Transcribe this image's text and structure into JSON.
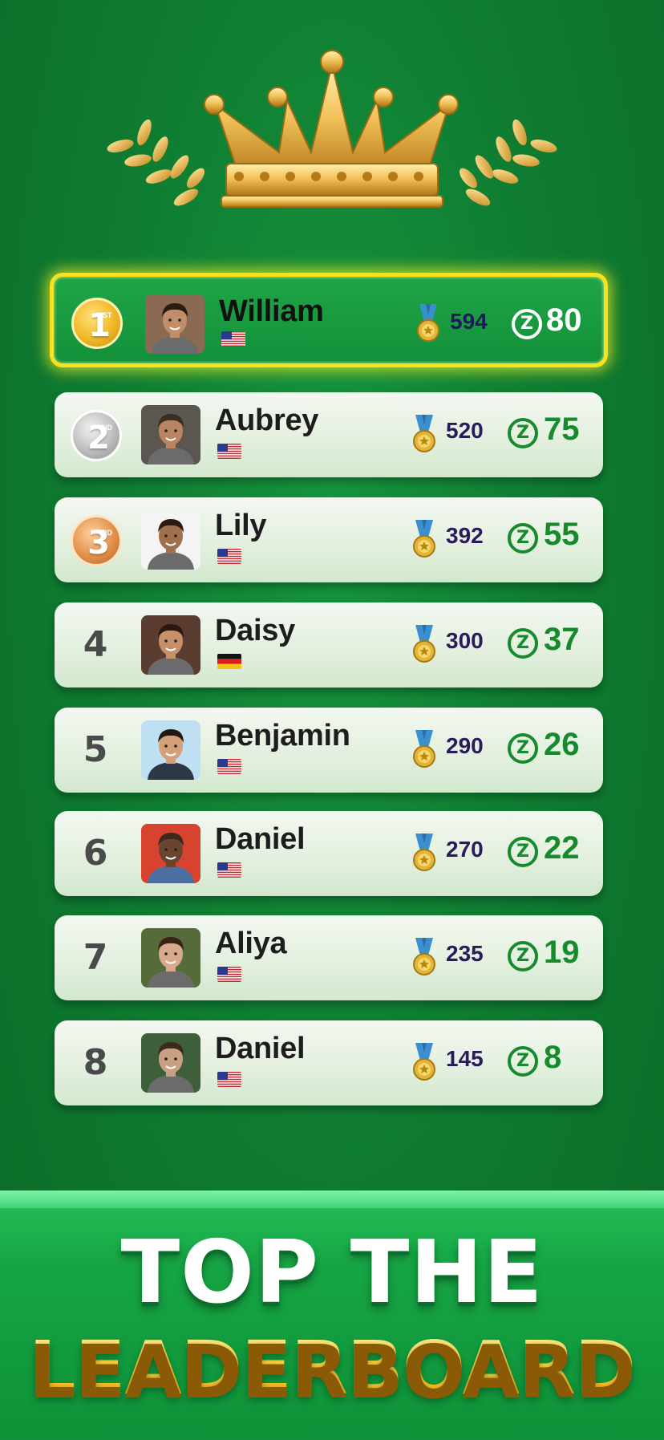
{
  "leaderboard": [
    {
      "rank": "1",
      "rank_suffix": "ST",
      "name": "William",
      "flag": "us-flag",
      "score": "594",
      "points": "80",
      "avatar_bg": "#8a6a52",
      "skin": "#c18d6a",
      "hair": "#2a1b12"
    },
    {
      "rank": "2",
      "rank_suffix": "ND",
      "name": "Aubrey",
      "flag": "us-flag",
      "score": "520",
      "points": "75",
      "avatar_bg": "#5b5650",
      "skin": "#b98562",
      "hair": "#3a2d22"
    },
    {
      "rank": "3",
      "rank_suffix": "RD",
      "name": "Lily",
      "flag": "us-flag",
      "score": "392",
      "points": "55",
      "avatar_bg": "#f4f4f4",
      "skin": "#a0704c",
      "hair": "#2b1a10"
    },
    {
      "rank": "4",
      "rank_suffix": "",
      "name": "Daisy",
      "flag": "de-flag",
      "score": "300",
      "points": "37",
      "avatar_bg": "#5a3d30",
      "skin": "#c6906a",
      "hair": "#2a1710"
    },
    {
      "rank": "5",
      "rank_suffix": "",
      "name": "Benjamin",
      "flag": "us-flag",
      "score": "290",
      "points": "26",
      "avatar_bg": "#bfe0f2",
      "skin": "#d3a07a",
      "hair": "#241812"
    },
    {
      "rank": "6",
      "rank_suffix": "",
      "name": "Daniel",
      "flag": "us-flag",
      "score": "270",
      "points": "22",
      "avatar_bg": "#d8432f",
      "skin": "#6b4430",
      "hair": "#3a2a1e"
    },
    {
      "rank": "7",
      "rank_suffix": "",
      "name": "Aliya",
      "flag": "us-flag",
      "score": "235",
      "points": "19",
      "avatar_bg": "#556b3a",
      "skin": "#d8a98a",
      "hair": "#3a2217"
    },
    {
      "rank": "8",
      "rank_suffix": "",
      "name": "Daniel",
      "flag": "us-flag",
      "score": "145",
      "points": "8",
      "avatar_bg": "#3d5f3a",
      "skin": "#caa082",
      "hair": "#3b2a1c"
    }
  ],
  "points_icon": "z-coin-icon",
  "score_icon": "medal-icon",
  "banner": {
    "line1": "TOP THE",
    "line2": "LEADERBOARD"
  },
  "colors": {
    "background": "#0f7d32",
    "highlight_border": "#f7e21f",
    "points_green": "#168a2c",
    "banner_gold": "#fbd23a"
  }
}
